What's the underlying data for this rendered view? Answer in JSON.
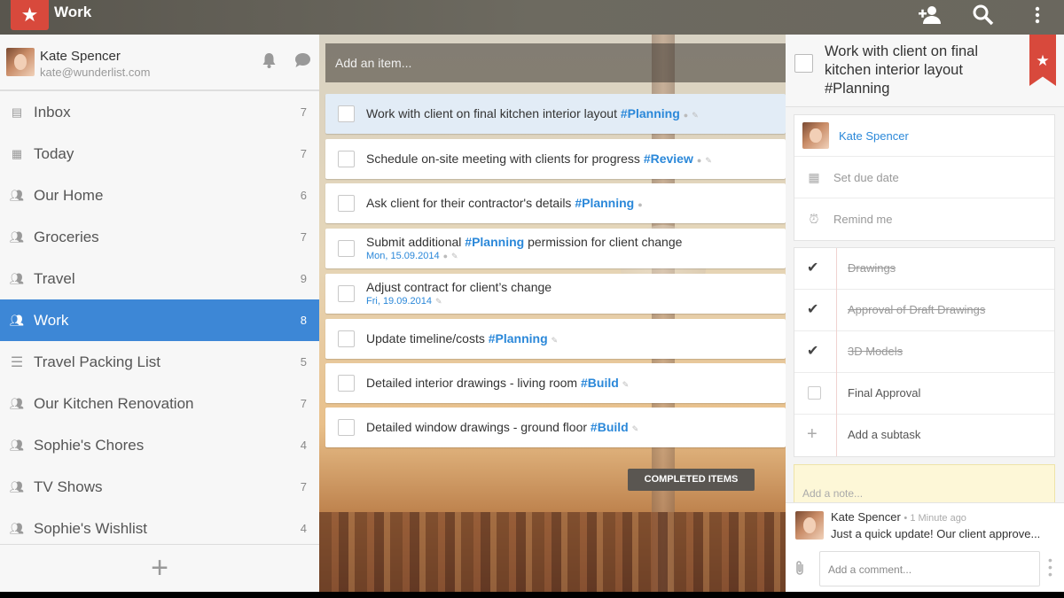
{
  "header": {
    "list_title": "Work",
    "icons": {
      "logo": "star-icon",
      "add_member": "add-person-icon",
      "search": "search-icon",
      "menu": "more-vertical-icon"
    }
  },
  "sidebar": {
    "user": {
      "name": "Kate Spencer",
      "email": "kate@wunderlist.com"
    },
    "lists": [
      {
        "label": "Inbox",
        "count": "7",
        "icon": "inbox-icon"
      },
      {
        "label": "Today",
        "count": "7",
        "icon": "calendar-icon"
      },
      {
        "label": "Our Home",
        "count": "6",
        "icon": "shared-users-icon"
      },
      {
        "label": "Groceries",
        "count": "7",
        "icon": "shared-users-icon"
      },
      {
        "label": "Travel",
        "count": "9",
        "icon": "shared-users-icon"
      },
      {
        "label": "Work",
        "count": "8",
        "icon": "shared-users-icon",
        "active": true
      },
      {
        "label": "Travel Packing List",
        "count": "5",
        "icon": "list-icon"
      },
      {
        "label": "Our Kitchen Renovation",
        "count": "7",
        "icon": "shared-users-icon"
      },
      {
        "label": "Sophie's Chores",
        "count": "4",
        "icon": "shared-users-icon"
      },
      {
        "label": "TV Shows",
        "count": "7",
        "icon": "shared-users-icon"
      },
      {
        "label": "Sophie's Wishlist",
        "count": "4",
        "icon": "shared-users-icon"
      }
    ],
    "add_list_symbol": "+"
  },
  "main": {
    "add_item_placeholder": "Add an item...",
    "tasks": [
      {
        "text": "Work with client on final kitchen interior layout ",
        "tag": "#Planning",
        "after": "",
        "due": ""
      },
      {
        "text": "Schedule on-site meeting with clients for progress ",
        "tag": "#Review",
        "after": "",
        "due": ""
      },
      {
        "text": "Ask client for their contractor's details ",
        "tag": "#Planning",
        "after": "",
        "due": ""
      },
      {
        "text": "Submit additional ",
        "tag": "#Planning",
        "after": " permission for client change",
        "due": "Mon, 15.09.2014"
      },
      {
        "text": "Adjust contract for client’s change",
        "tag": "",
        "after": "",
        "due": "Fri, 19.09.2014"
      },
      {
        "text": "Update timeline/costs ",
        "tag": "#Planning",
        "after": "",
        "due": ""
      },
      {
        "text": "Detailed interior drawings - living room ",
        "tag": "#Build",
        "after": "",
        "due": ""
      },
      {
        "text": "Detailed window drawings - ground floor ",
        "tag": "#Build",
        "after": "",
        "due": ""
      }
    ],
    "completed_label": "COMPLETED ITEMS"
  },
  "detail": {
    "title": "Work with client on final kitchen interior layout #Planning",
    "assignee": "Kate Spencer",
    "due_label": "Set due date",
    "remind_label": "Remind me",
    "subtasks": [
      {
        "label": "Drawings",
        "done": true
      },
      {
        "label": "Approval of Draft Drawings",
        "done": true
      },
      {
        "label": "3D Models",
        "done": true
      },
      {
        "label": "Final Approval",
        "done": false
      }
    ],
    "add_subtask_label": "Add a subtask",
    "note_placeholder": "Add a note...",
    "comment": {
      "author": "Kate Spencer",
      "time": "1 Minute ago",
      "text": "Just a quick update! Our client approve..."
    },
    "comment_placeholder": "Add a comment..."
  }
}
